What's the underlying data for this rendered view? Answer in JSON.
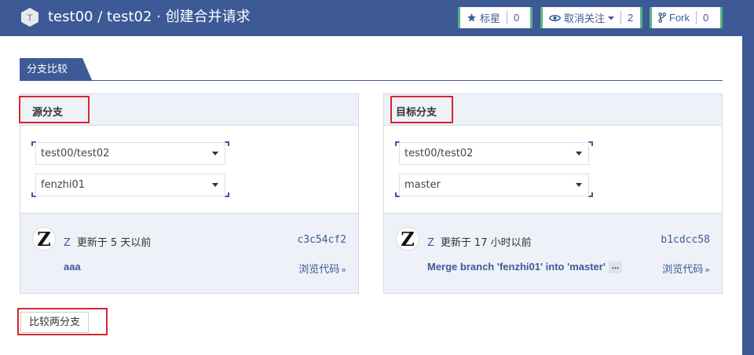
{
  "header": {
    "title": "test00 / test02 · 创建合并请求",
    "avatar_letter": "T",
    "buttons": {
      "star_label": "标星",
      "star_count": "0",
      "watch_label": "取消关注",
      "watch_count": "2",
      "fork_label": "Fork",
      "fork_count": "0"
    }
  },
  "tabs": {
    "active": "分支比较"
  },
  "source": {
    "title": "源分支",
    "repo": "test00/test02",
    "branch": "fenzhi01",
    "commit": {
      "avatar": "Z",
      "author": "Z",
      "updated_prefix": "更新于",
      "time": "5 天以前",
      "sha": "c3c54cf2",
      "message": "aaa",
      "browse_label": "浏览代码",
      "browse_arrow": "»"
    }
  },
  "target": {
    "title": "目标分支",
    "repo": "test00/test02",
    "branch": "master",
    "commit": {
      "avatar": "Z",
      "author": "Z",
      "updated_prefix": "更新于",
      "time": "17 小时以前",
      "sha": "b1cdcc58",
      "message": "Merge branch 'fenzhi01' into 'master'",
      "ellipsis": "...",
      "browse_label": "浏览代码",
      "browse_arrow": "»"
    }
  },
  "compare_button": "比较两分支",
  "colors": {
    "brand": "#3d5a96",
    "accent": "#57b380",
    "highlight": "#d6272e",
    "panel_bg": "#eef1f8"
  }
}
